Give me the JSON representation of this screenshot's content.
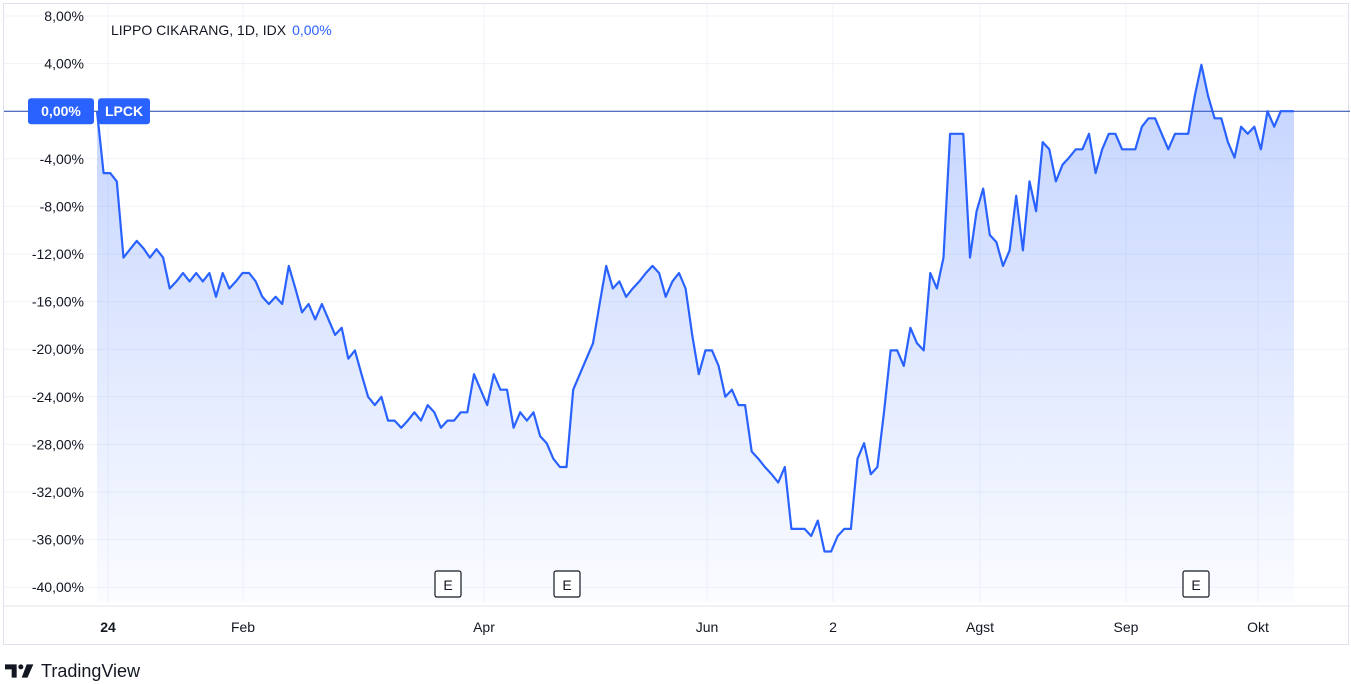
{
  "chart_data": {
    "type": "area",
    "title": "LIPPO CIKARANG, 1D, IDX",
    "legend_change": "0,00%",
    "symbol_label": "LPCK",
    "last_value_label": "0,00%",
    "y_unit": "percent",
    "ylim": [
      -42,
      8.9
    ],
    "y_ticks": [
      {
        "value": 8,
        "label": "8,00%"
      },
      {
        "value": 4,
        "label": "4,00%"
      },
      {
        "value": -4,
        "label": "-4,00%"
      },
      {
        "value": -8,
        "label": "-8,00%"
      },
      {
        "value": -12,
        "label": "-12,00%"
      },
      {
        "value": -16,
        "label": "-16,00%"
      },
      {
        "value": -20,
        "label": "-20,00%"
      },
      {
        "value": -24,
        "label": "-24,00%"
      },
      {
        "value": -28,
        "label": "-28,00%"
      },
      {
        "value": -32,
        "label": "-32,00%"
      },
      {
        "value": -36,
        "label": "-36,00%"
      },
      {
        "value": -40,
        "label": "-40,00%"
      }
    ],
    "x_ticks": [
      "24",
      "Feb",
      "Apr",
      "Jun",
      "2",
      "Agst",
      "Sep",
      "Okt"
    ],
    "earnings_markers": [
      "E",
      "E",
      "E"
    ],
    "grid": true,
    "colors": {
      "line": "#2962ff",
      "fill": "#2962ff",
      "text": "#131722",
      "grid": "#f0f3fa",
      "accent": "#2962ff"
    },
    "series": [
      {
        "values": [
          0.0,
          -5.2,
          -5.2,
          -5.9,
          -12.3,
          -11.6,
          -10.9,
          -11.5,
          -12.3,
          -11.6,
          -12.3,
          -14.9,
          -14.3,
          -13.6,
          -14.3,
          -13.6,
          -14.3,
          -13.6,
          -15.6,
          -13.6,
          -14.9,
          -14.3,
          -13.6,
          -13.6,
          -14.3,
          -15.6,
          -16.2,
          -15.6,
          -16.2,
          -13.0,
          -14.9,
          -16.9,
          -16.2,
          -17.5,
          -16.2,
          -17.5,
          -18.8,
          -18.2,
          -20.8,
          -20.1,
          -22.1,
          -24.0,
          -24.7,
          -24.0,
          -26.0,
          -26.0,
          -26.6,
          -26.0,
          -25.3,
          -26.0,
          -24.7,
          -25.3,
          -26.6,
          -26.0,
          -26.0,
          -25.3,
          -25.3,
          -22.1,
          -23.4,
          -24.7,
          -22.1,
          -23.4,
          -23.4,
          -26.6,
          -25.3,
          -26.0,
          -25.3,
          -27.3,
          -27.9,
          -29.2,
          -29.9,
          -29.9,
          -23.4,
          -22.1,
          -20.8,
          -19.5,
          -16.2,
          -13.0,
          -14.9,
          -14.3,
          -15.6,
          -14.9,
          -14.3,
          -13.6,
          -13.0,
          -13.6,
          -15.6,
          -14.3,
          -13.6,
          -14.9,
          -18.8,
          -22.1,
          -20.1,
          -20.1,
          -21.4,
          -24.0,
          -23.4,
          -24.7,
          -24.7,
          -28.6,
          -29.2,
          -29.9,
          -30.5,
          -31.2,
          -29.9,
          -35.1,
          -35.1,
          -35.1,
          -35.7,
          -34.4,
          -37.0,
          -37.0,
          -35.7,
          -35.1,
          -35.1,
          -29.2,
          -27.9,
          -30.5,
          -29.9,
          -25.3,
          -20.1,
          -20.1,
          -21.4,
          -18.2,
          -19.5,
          -20.1,
          -13.6,
          -14.9,
          -12.3,
          -1.9,
          -1.9,
          -1.9,
          -12.3,
          -8.4,
          -6.5,
          -10.4,
          -11.0,
          -13.0,
          -11.7,
          -7.1,
          -11.7,
          -5.9,
          -8.4,
          -2.6,
          -3.2,
          -5.9,
          -4.5,
          -3.9,
          -3.2,
          -3.2,
          -1.9,
          -5.2,
          -3.2,
          -1.9,
          -1.9,
          -3.2,
          -3.2,
          -3.2,
          -1.3,
          -0.6,
          -0.6,
          -1.9,
          -3.2,
          -1.9,
          -1.9,
          -1.9,
          1.3,
          3.9,
          1.3,
          -0.6,
          -0.6,
          -2.6,
          -3.9,
          -1.3,
          -1.9,
          -1.3,
          -3.2,
          0.0,
          -1.3,
          0.0,
          0.0,
          0.0
        ]
      }
    ]
  },
  "branding": {
    "name": "TradingView"
  }
}
